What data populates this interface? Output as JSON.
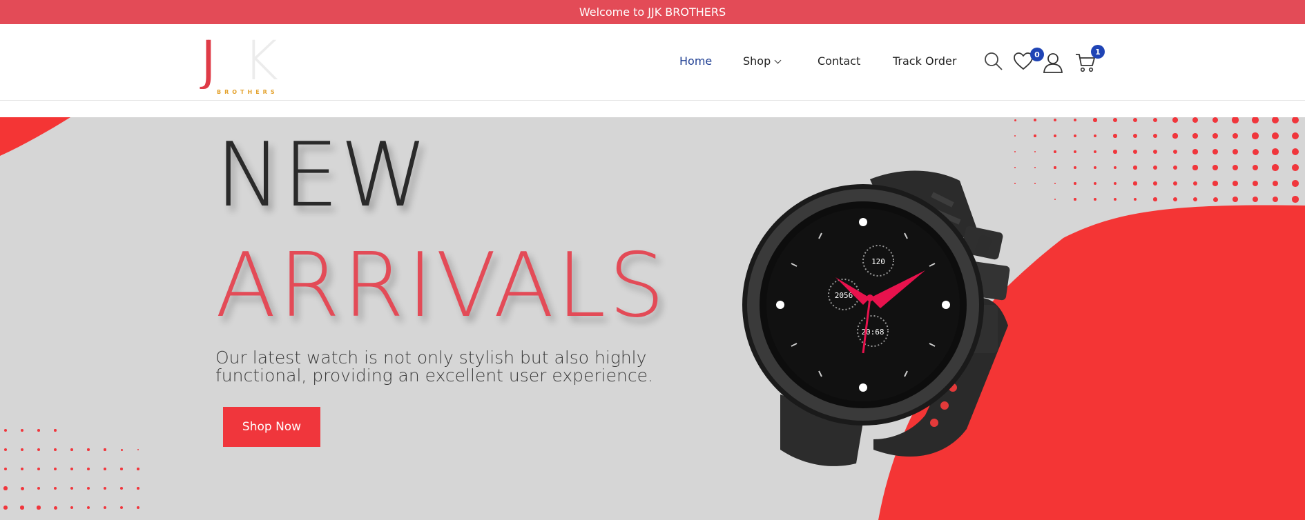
{
  "topbar": {
    "welcome_text": "Welcome to JJK BROTHERS"
  },
  "logo": {
    "letters_primary": "JJ",
    "letters_secondary": "K",
    "subtitle": "BROTHERS"
  },
  "nav": {
    "items": [
      {
        "label": "Home",
        "active": true
      },
      {
        "label": "Shop",
        "has_dropdown": true
      },
      {
        "label": "Contact"
      },
      {
        "label": "Track Order"
      }
    ]
  },
  "header_icons": {
    "search": "search-icon",
    "wishlist": {
      "icon": "heart-icon",
      "count": "0"
    },
    "account": "user-icon",
    "cart": {
      "icon": "cart-icon",
      "count": "1"
    }
  },
  "hero": {
    "title_line1": "NEW",
    "title_line2": "ARRIVALS",
    "description": "Our latest watch is not only stylish but also highly functional, providing an excellent user experience.",
    "cta_label": "Shop Now",
    "watch_readouts": {
      "top": "120",
      "left": "2056",
      "bottom": "20:68"
    }
  },
  "colors": {
    "accent": "#e34b57",
    "cta": "#f0363c",
    "badge": "#1f44b5",
    "nav_active": "#1f3f93",
    "hero_bg": "#d6d6d6"
  }
}
